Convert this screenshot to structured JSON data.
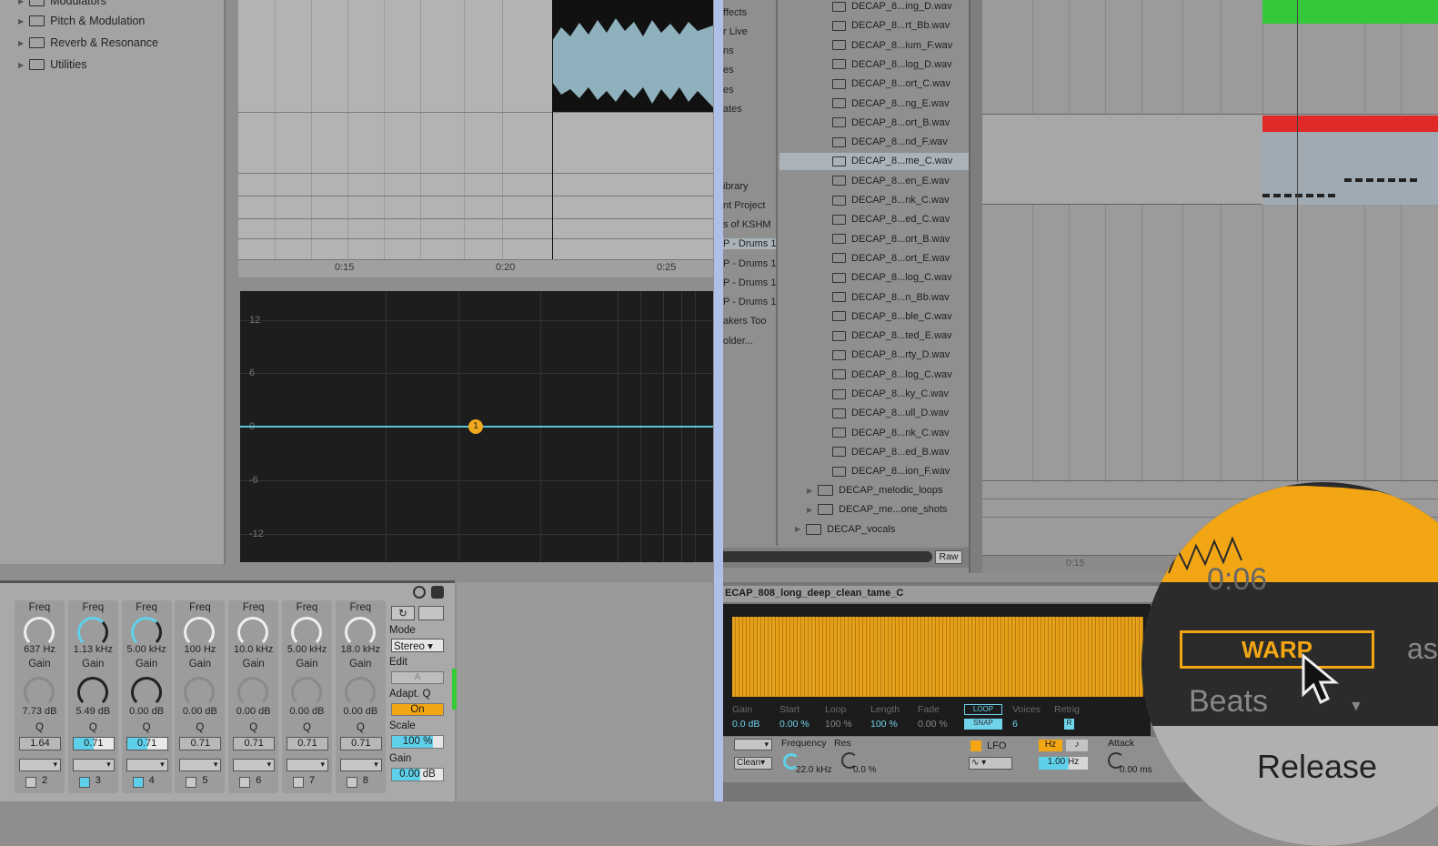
{
  "left_browser": {
    "items": [
      {
        "label": "Modulators"
      },
      {
        "label": "Pitch & Modulation"
      },
      {
        "label": "Reverb & Resonance"
      },
      {
        "label": "Utilities"
      }
    ]
  },
  "left_arrangement": {
    "timeline": [
      "0:15",
      "0:20",
      "0:25"
    ]
  },
  "eq_display": {
    "y_labels": [
      "12",
      "6",
      "0",
      "-6",
      "-12"
    ],
    "active_point": "1",
    "curve_color": "#5fc6d8",
    "point_color": "#f0a91c"
  },
  "eq_device": {
    "bands": [
      {
        "freq_label": "Freq",
        "freq": "637 Hz",
        "gain_label": "Gain",
        "gain": "7.73 dB",
        "q_label": "Q",
        "q": "1.64",
        "num": "2",
        "on": false
      },
      {
        "freq_label": "Freq",
        "freq": "1.13 kHz",
        "gain_label": "Gain",
        "gain": "5.49 dB",
        "q_label": "Q",
        "q": "0.71",
        "num": "3",
        "on": true
      },
      {
        "freq_label": "Freq",
        "freq": "5.00 kHz",
        "gain_label": "Gain",
        "gain": "0.00 dB",
        "q_label": "Q",
        "q": "0.71",
        "num": "4",
        "on": true
      },
      {
        "freq_label": "Freq",
        "freq": "100 Hz",
        "gain_label": "Gain",
        "gain": "0.00 dB",
        "q_label": "Q",
        "q": "0.71",
        "num": "5",
        "on": false
      },
      {
        "freq_label": "Freq",
        "freq": "10.0 kHz",
        "gain_label": "Gain",
        "gain": "0.00 dB",
        "q_label": "Q",
        "q": "0.71",
        "num": "6",
        "on": false
      },
      {
        "freq_label": "Freq",
        "freq": "5.00 kHz",
        "gain_label": "Gain",
        "gain": "0.00 dB",
        "q_label": "Q",
        "q": "0.71",
        "num": "7",
        "on": false
      },
      {
        "freq_label": "Freq",
        "freq": "18.0 kHz",
        "gain_label": "Gain",
        "gain": "0.00 dB",
        "q_label": "Q",
        "q": "0.71",
        "num": "8",
        "on": false
      }
    ],
    "mode_label": "Mode",
    "mode": "Stereo",
    "edit_label": "Edit",
    "edit": "A",
    "adaptq_label": "Adapt. Q",
    "adaptq": "On",
    "scale_label": "Scale",
    "scale": "100 %",
    "gain_label": "Gain",
    "gain": "0.00 dB"
  },
  "right_nav": [
    "ffects",
    "r Live",
    "ns",
    "es",
    "es",
    "ates",
    "ibrary",
    "nt Project",
    "s of KSHM",
    "P - Drums 1",
    "P - Drums 1",
    "P - Drums 1",
    "P - Drums 1",
    "akers Too",
    "older..."
  ],
  "files": [
    "DECAP_8...ing_D.wav",
    "DECAP_8...rt_Bb.wav",
    "DECAP_8...ium_F.wav",
    "DECAP_8...log_D.wav",
    "DECAP_8...ort_C.wav",
    "DECAP_8...ng_E.wav",
    "DECAP_8...ort_B.wav",
    "DECAP_8...nd_F.wav",
    "DECAP_8...me_C.wav",
    "DECAP_8...en_E.wav",
    "DECAP_8...nk_C.wav",
    "DECAP_8...ed_C.wav",
    "DECAP_8...ort_B.wav",
    "DECAP_8...ort_E.wav",
    "DECAP_8...log_C.wav",
    "DECAP_8...n_Bb.wav",
    "DECAP_8...ble_C.wav",
    "DECAP_8...ted_E.wav",
    "DECAP_8...rty_D.wav",
    "DECAP_8...log_C.wav",
    "DECAP_8...ky_C.wav",
    "DECAP_8...ull_D.wav",
    "DECAP_8...nk_C.wav",
    "DECAP_8...ed_B.wav",
    "DECAP_8...ion_F.wav"
  ],
  "folders": [
    "DECAP_melodic_loops",
    "DECAP_me...one_shots",
    "DECAP_vocals"
  ],
  "raw_button": "Raw",
  "right_timeline": "0:15",
  "sampler": {
    "title": "ECAP_808_long_deep_clean_tame_C",
    "params": [
      {
        "label": "Gain",
        "value": "0.0 dB"
      },
      {
        "label": "Start",
        "value": "0.00 %"
      },
      {
        "label": "Loop",
        "value": "100 %"
      },
      {
        "label": "Length",
        "value": "100 %"
      },
      {
        "label": "Fade",
        "value": "0.00 %"
      }
    ],
    "loop": "LOOP",
    "snap": "SNAP",
    "voices_label": "Voices",
    "voices": "6",
    "retrig_label": "Retrig",
    "retrig": "R",
    "filter_type": "Clean",
    "frequency_label": "Frequency",
    "frequency": "22.0 kHz",
    "res_label": "Res",
    "res": "0.0 %",
    "lfo_label": "LFO",
    "hz_btn": "Hz",
    "note_btn": "♪",
    "lfo_rate": "1.00 Hz",
    "attack_label": "Attack",
    "attack": "0.00 ms"
  },
  "magnifier": {
    "time": "0:06",
    "warp": "WARP",
    "beats": "Beats",
    "release": "Release",
    "partial": "as"
  }
}
